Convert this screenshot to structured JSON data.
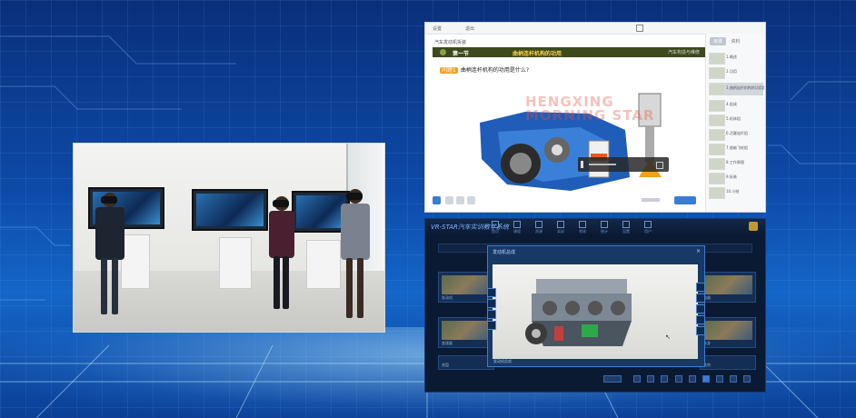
{
  "lms": {
    "top_left": "设置",
    "top_mid": "退出",
    "course": "汽车发动机拆装",
    "section_num": "1",
    "section_title": "第一节",
    "lesson_title": "曲柄连杆机构的功用",
    "banner_right": "汽车构造与维修",
    "question_tag": "问题1",
    "question": "曲柄连杆机构的功用是什么?",
    "watermark": [
      "HENGXING",
      "MORNING STAR"
    ],
    "tabs": [
      "目录",
      "资料"
    ],
    "chapters": [
      "1.概述",
      "2.功用",
      "3.曲柄连杆机构的功用是什么",
      "4.组成",
      "5.机体组",
      "6.活塞连杆组",
      "7.曲轴飞轮组",
      "8.工作原理",
      "9.拆装",
      "10.小结"
    ]
  },
  "vr": {
    "brand": "VR-STAR汽车实训教学系统",
    "nav": [
      "首页",
      "课程",
      "资源",
      "实训",
      "考核",
      "统计",
      "设置",
      "用户"
    ],
    "modal_title": "发动机总成",
    "modal_close": "×",
    "modal_footer": "发动机总成",
    "cards": [
      "发动机",
      "变速器",
      "底盘",
      "电器",
      "车身",
      "其他"
    ],
    "pager_go": "跳转",
    "pages": [
      "1",
      "2",
      "3",
      "4",
      "5",
      "6",
      "7",
      "8",
      "9"
    ]
  },
  "colors": {
    "banner": "#3c4a1c",
    "accent": "#3a7bd5",
    "vr_bg": "#0b1a33"
  }
}
